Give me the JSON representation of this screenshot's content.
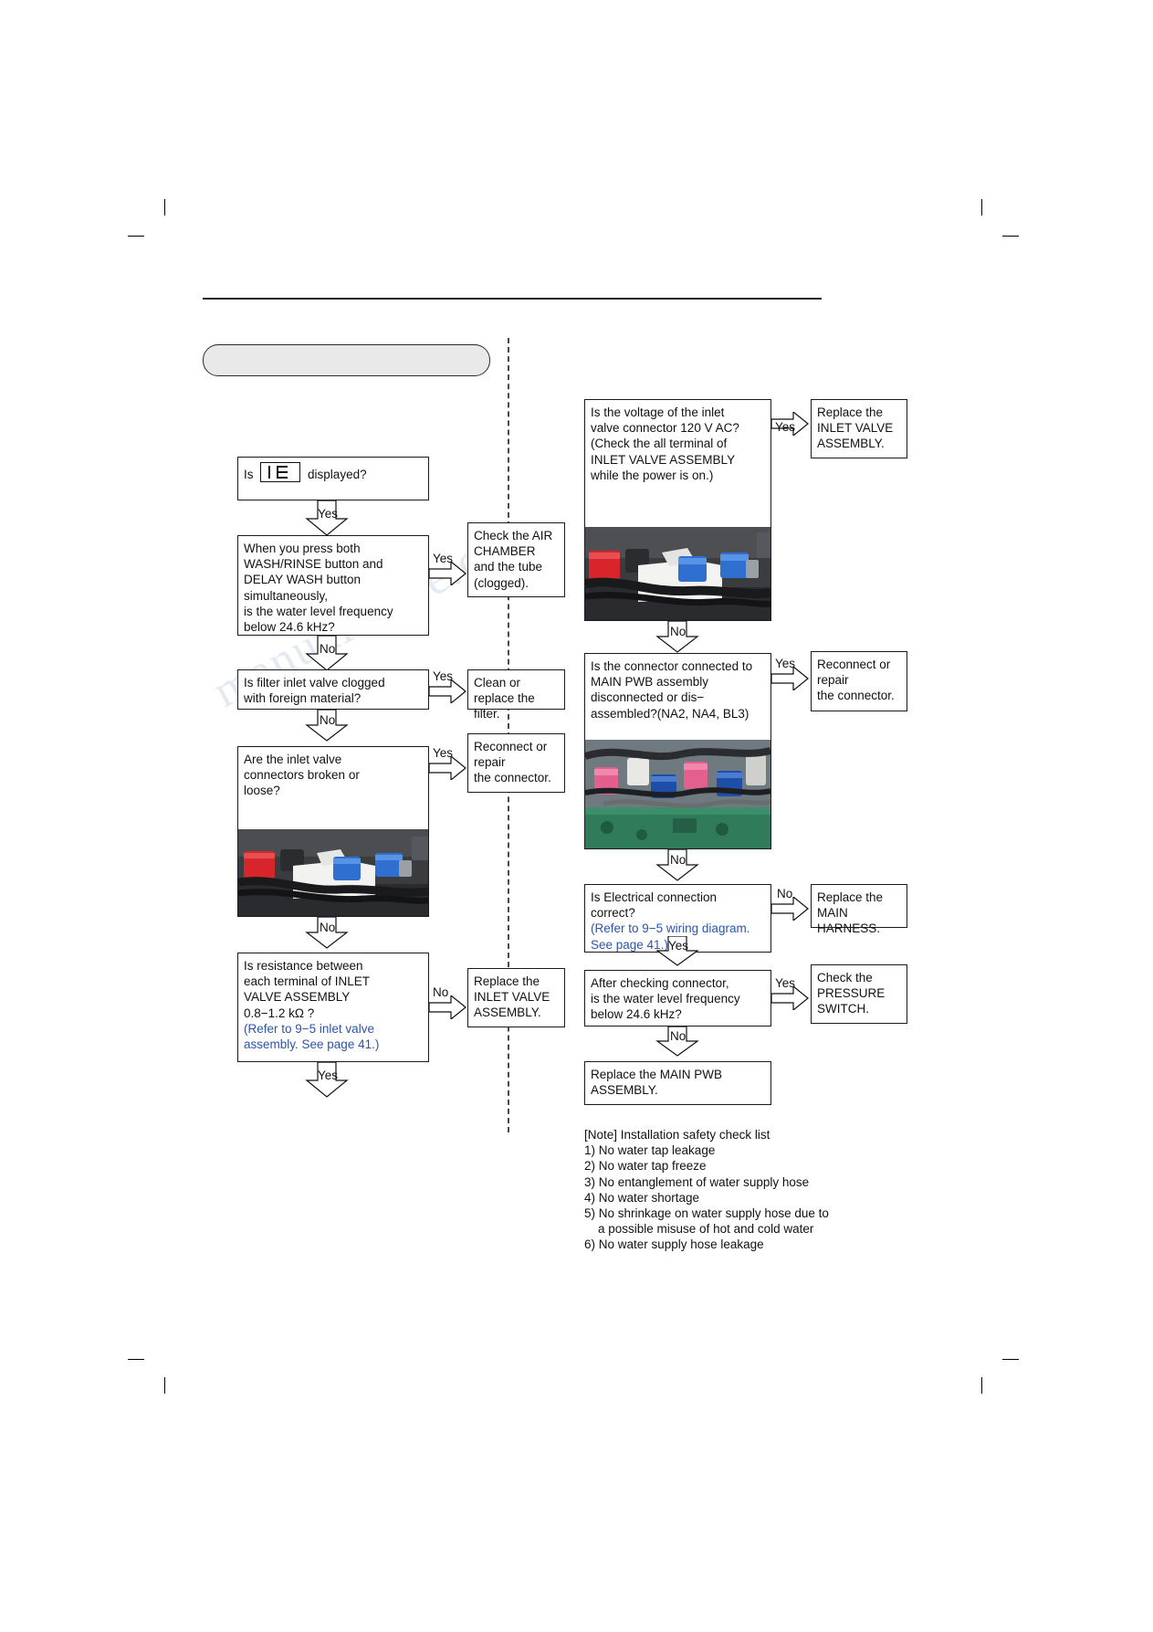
{
  "document": {
    "watermark": "manualshive.com"
  },
  "flow": {
    "start_label": "",
    "left": {
      "q1": "Is          displayed?",
      "q1_prefix": "Is",
      "q1_suffix": "displayed?",
      "q2": "When you press both\nWASH/RINSE  button and\nDELAY WASH  button\nsimultaneously,\nis the water level frequency\nbelow 24.6 kHz?",
      "a2": "Check the AIR\nCHAMBER\nand the tube\n(clogged).",
      "q3": "Is filter inlet valve clogged\nwith foreign material?",
      "a3": "Clean or\nreplace the filter.",
      "q4": "Are the inlet valve\nconnectors broken or\nloose?",
      "a4": "Reconnect or\nrepair\nthe connector.",
      "q5_line1": "Is resistance between",
      "q5_line2": "each terminal of INLET",
      "q5_line3": "VALVE ASSEMBLY",
      "q5_line4": "0.8−1.2 kΩ ?",
      "q5_ref1": "(Refer to 9−5 inlet valve",
      "q5_ref2": "assembly. See page 41.)",
      "a5": "Replace the\nINLET VALVE\nASSEMBLY."
    },
    "right": {
      "q6_line1": "Is the voltage of the inlet",
      "q6_line2": "valve connector 120 V AC?",
      "q6_line3": "(Check the all terminal of",
      "q6_line4": " INLET VALVE ASSEMBLY",
      "q6_line5": " while the power is on.)",
      "a6": "Replace the\nINLET VALVE\nASSEMBLY.",
      "q7_line1": "Is the connector connected to",
      "q7_line2": "MAIN PWB assembly",
      "q7_line3": "disconnected or dis−",
      "q7_line4": "assembled?(NA2, NA4, BL3)",
      "a7": "Reconnect or\nrepair\nthe connector.",
      "q8_line1": "Is Electrical connection",
      "q8_line2": "correct?",
      "q8_ref1": "(Refer to 9−5 wiring diagram.",
      "q8_ref2": " See page 41.)",
      "a8": "Replace the\nMAIN HARNESS.",
      "q9": "After checking connector,\nis the water level frequency\nbelow 24.6 kHz?",
      "a9": "Check the\nPRESSURE\nSWITCH.",
      "end": "Replace the MAIN PWB\nASSEMBLY."
    },
    "labels": {
      "yes": "Yes",
      "no": "No"
    }
  },
  "note": {
    "title": "[Note] Installation safety check list",
    "items": [
      "1) No water tap leakage",
      "2) No water tap freeze",
      "3) No entanglement of water supply hose",
      "4) No water shortage",
      "5) No shrinkage on water supply hose due to",
      "    a possible misuse of hot and cold water",
      "6) No water supply hose leakage"
    ]
  }
}
